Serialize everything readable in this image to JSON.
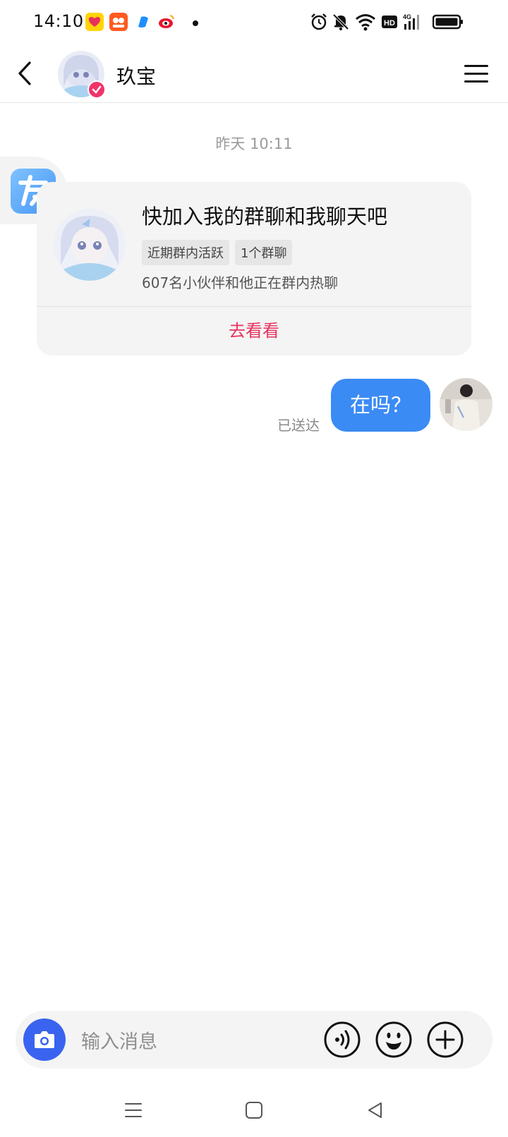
{
  "status_bar": {
    "time": "14:10",
    "notification_apps": [
      "lottery-app-icon",
      "taobao-app-icon",
      "blue-app-icon",
      "weibo-app-icon"
    ],
    "network": "4G",
    "hd_label": "HD"
  },
  "header": {
    "contact_name": "玖宝",
    "verified": true
  },
  "chat": {
    "timestamp": "昨天 10:11",
    "side_badge_icon": "friend-badge-icon",
    "group_card": {
      "title": "快加入我的群聊和我聊天吧",
      "tags": [
        "近期群内活跃",
        "1个群聊"
      ],
      "subtitle": "607名小伙伴和他正在群内热聊",
      "action_label": "去看看"
    },
    "outgoing_message": {
      "text": "在吗？",
      "status": "已送达"
    }
  },
  "input_bar": {
    "placeholder": "输入消息",
    "buttons": [
      "camera-icon",
      "voice-icon",
      "emoji-icon",
      "plus-icon"
    ]
  },
  "colors": {
    "accent_blue": "#3b8bf5",
    "action_red": "#e8325e",
    "verified_pink": "#f0346b",
    "camera_blue": "#3a63f0"
  }
}
